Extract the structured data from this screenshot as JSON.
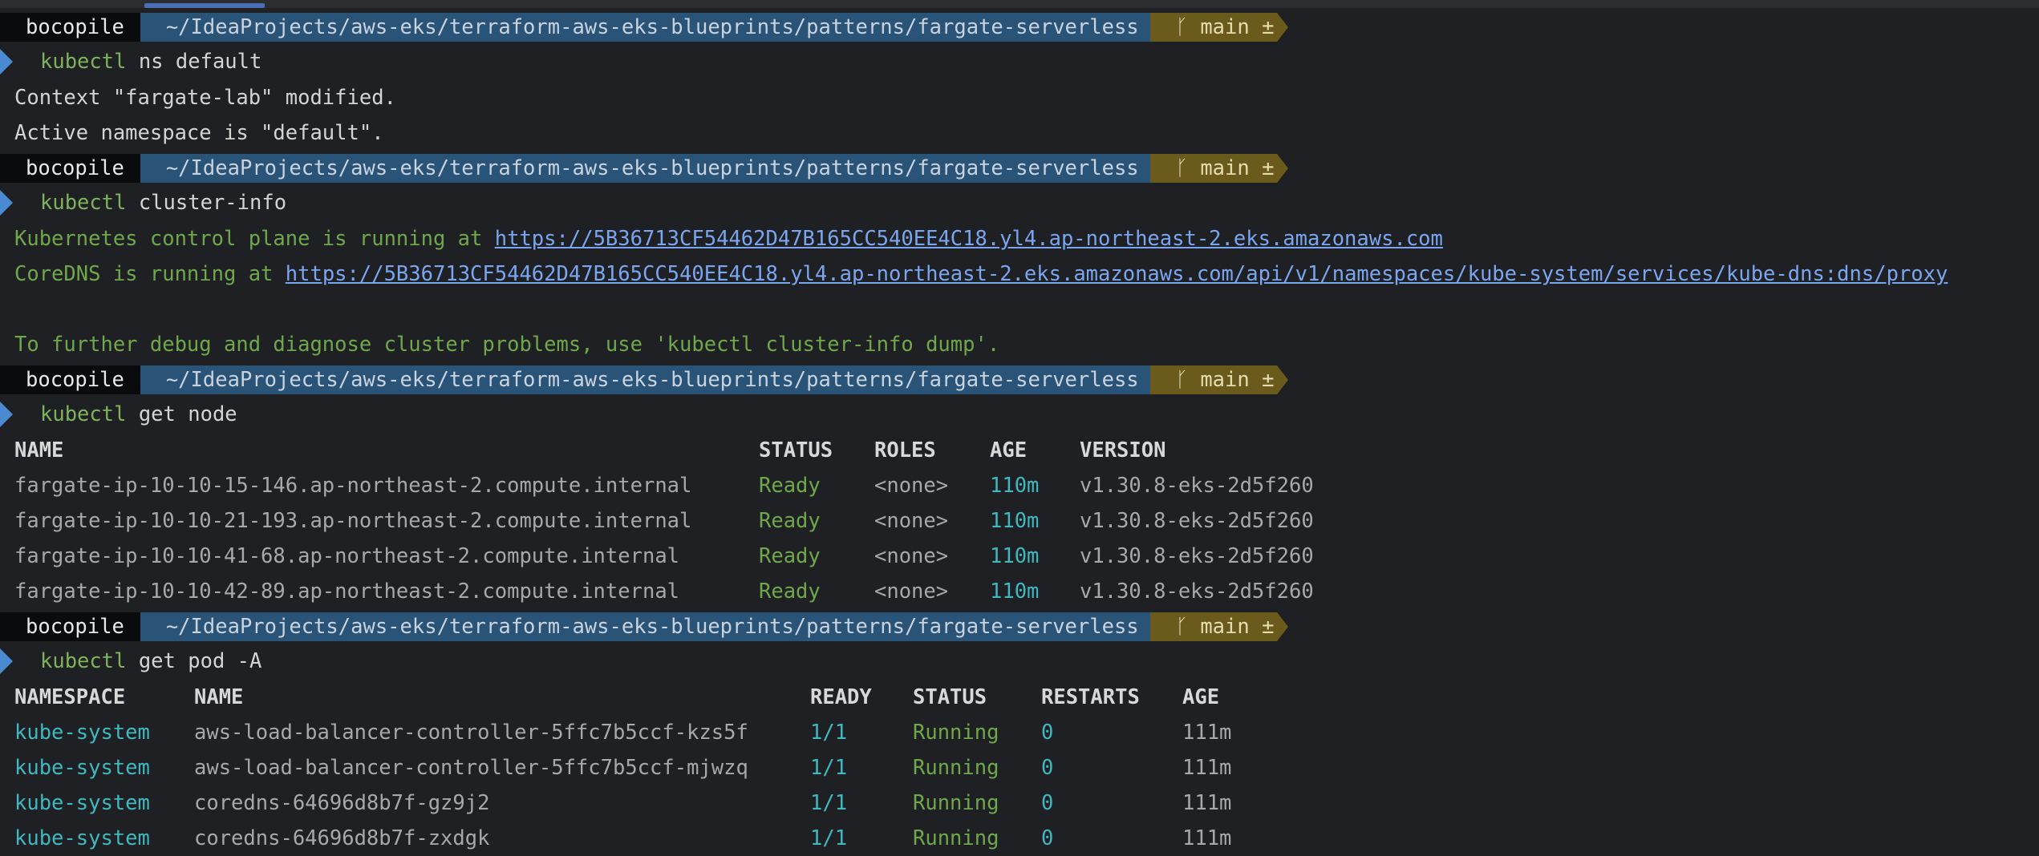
{
  "prompt": {
    "user": "bocopile",
    "path": "~/IdeaProjects/aws-eks/terraform-aws-eks-blueprints/patterns/fargate-serverless",
    "git": "ᚴ main ±"
  },
  "blocks": {
    "ns": {
      "cmd": "kubectl",
      "args": "ns default",
      "out1": "Context \"fargate-lab\" modified.",
      "out2": "Active namespace is \"default\"."
    },
    "cluster": {
      "cmd": "kubectl",
      "args": "cluster-info",
      "cp_prefix": "Kubernetes control plane is running at ",
      "cp_url": "https://5B36713CF54462D47B165CC540EE4C18.yl4.ap-northeast-2.eks.amazonaws.com",
      "dns_prefix": "CoreDNS is running at ",
      "dns_url": "https://5B36713CF54462D47B165CC540EE4C18.yl4.ap-northeast-2.eks.amazonaws.com/api/v1/namespaces/kube-system/services/kube-dns:dns/proxy",
      "debug": "To further debug and diagnose cluster problems, use 'kubectl cluster-info dump'."
    },
    "nodes": {
      "cmd": "kubectl",
      "args": "get node",
      "headers": [
        "NAME",
        "STATUS",
        "ROLES",
        "AGE",
        "VERSION"
      ],
      "rows": [
        [
          "fargate-ip-10-10-15-146.ap-northeast-2.compute.internal",
          "Ready",
          "<none>",
          "110m",
          "v1.30.8-eks-2d5f260"
        ],
        [
          "fargate-ip-10-10-21-193.ap-northeast-2.compute.internal",
          "Ready",
          "<none>",
          "110m",
          "v1.30.8-eks-2d5f260"
        ],
        [
          "fargate-ip-10-10-41-68.ap-northeast-2.compute.internal",
          "Ready",
          "<none>",
          "110m",
          "v1.30.8-eks-2d5f260"
        ],
        [
          "fargate-ip-10-10-42-89.ap-northeast-2.compute.internal",
          "Ready",
          "<none>",
          "110m",
          "v1.30.8-eks-2d5f260"
        ]
      ]
    },
    "pods": {
      "cmd": "kubectl",
      "args": "get pod -A",
      "headers": [
        "NAMESPACE",
        "NAME",
        "READY",
        "STATUS",
        "RESTARTS",
        "AGE"
      ],
      "rows": [
        [
          "kube-system",
          "aws-load-balancer-controller-5ffc7b5ccf-kzs5f",
          "1/1",
          "Running",
          "0",
          "111m"
        ],
        [
          "kube-system",
          "aws-load-balancer-controller-5ffc7b5ccf-mjwzq",
          "1/1",
          "Running",
          "0",
          "111m"
        ],
        [
          "kube-system",
          "coredns-64696d8b7f-gz9j2",
          "1/1",
          "Running",
          "0",
          "111m"
        ],
        [
          "kube-system",
          "coredns-64696d8b7f-zxdgk",
          "1/1",
          "Running",
          "0",
          "111m"
        ]
      ]
    }
  }
}
